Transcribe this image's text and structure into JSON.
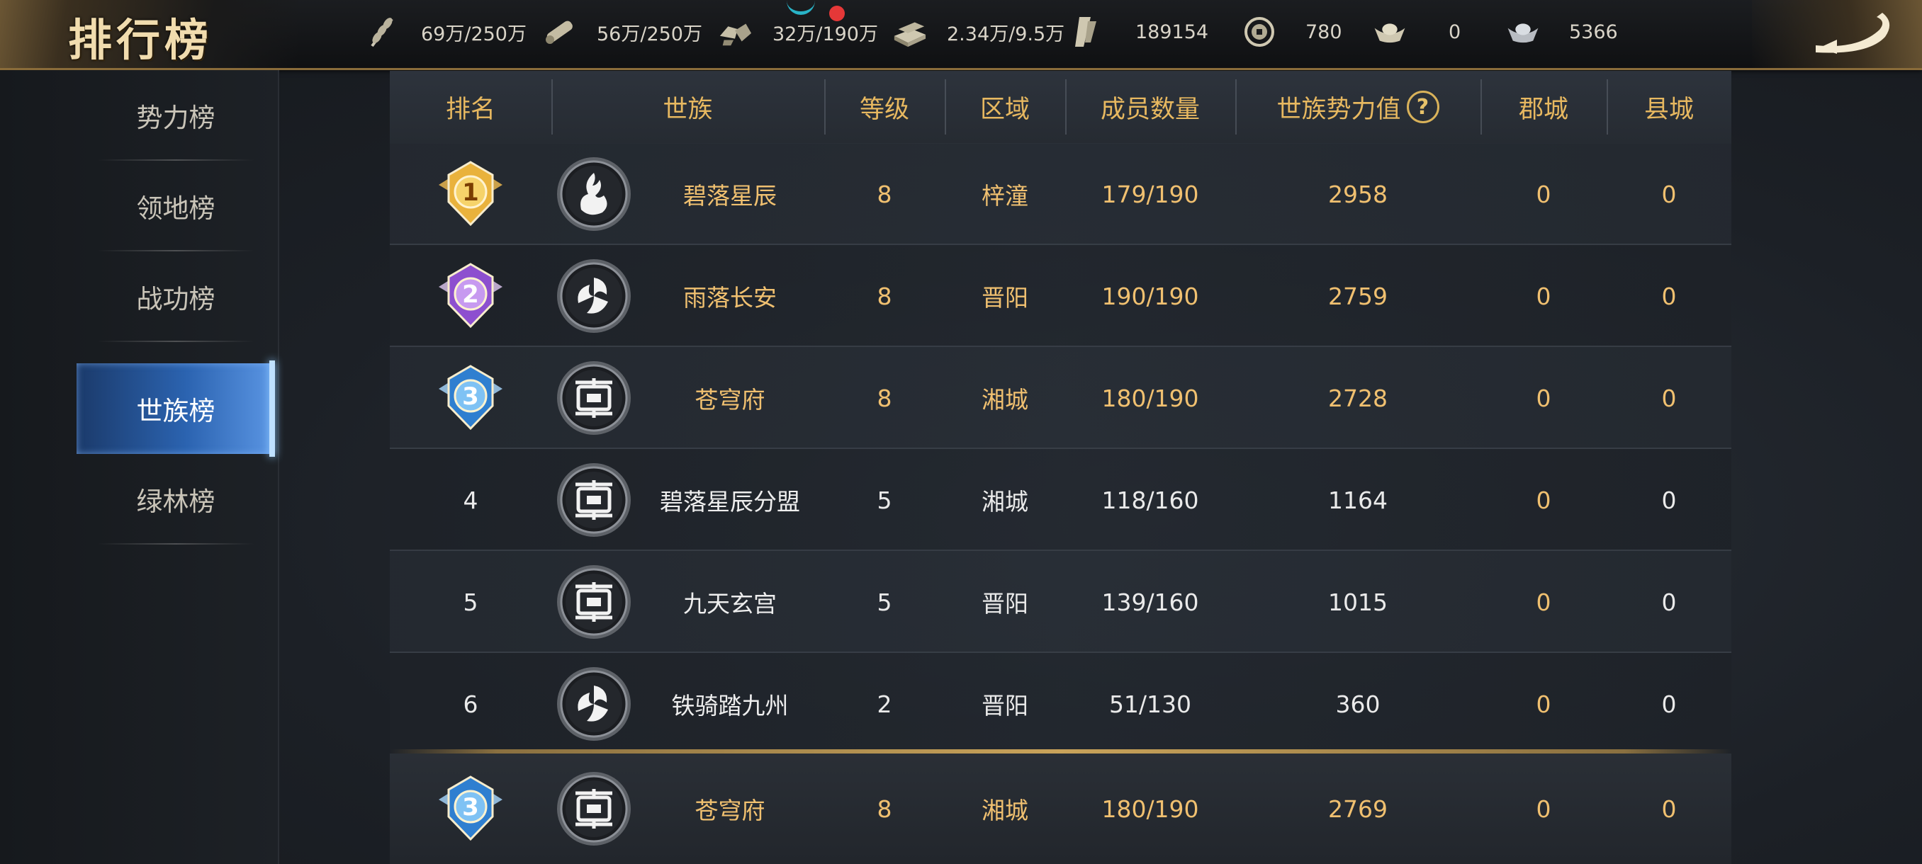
{
  "header": {
    "title": "排行榜",
    "resources": [
      {
        "icon": "grain-icon",
        "value": "69万/250万"
      },
      {
        "icon": "wood-icon",
        "value": "56万/250万"
      },
      {
        "icon": "stone-icon",
        "value": "32万/190万"
      },
      {
        "icon": "iron-icon",
        "value": "2.34万/9.5万"
      },
      {
        "icon": "decree-icon",
        "value": "189154"
      },
      {
        "icon": "copper-coin-icon",
        "value": "780"
      },
      {
        "icon": "gold-ingot-icon",
        "value": "0"
      },
      {
        "icon": "silver-ingot-icon",
        "value": "5366"
      }
    ],
    "back_icon": "back-arrow-icon"
  },
  "sidebar": {
    "items": [
      {
        "label": "势力榜",
        "active": false
      },
      {
        "label": "领地榜",
        "active": false
      },
      {
        "label": "战功榜",
        "active": false
      },
      {
        "label": "世族榜",
        "active": true
      },
      {
        "label": "绿林榜",
        "active": false
      }
    ]
  },
  "table": {
    "columns": [
      "排名",
      "世族",
      "等级",
      "区域",
      "成员数量",
      "世族势力值",
      "郡城",
      "县城"
    ],
    "help_icon": "?",
    "rows": [
      {
        "rank": "1",
        "medal": "gold",
        "emblem": "flame",
        "name": "碧落星辰",
        "level": "8",
        "region": "梓潼",
        "members": "179/190",
        "power": "2958",
        "jun": "0",
        "xian": "0",
        "style": "gold"
      },
      {
        "rank": "2",
        "medal": "purple",
        "emblem": "swirl",
        "name": "雨落长安",
        "level": "8",
        "region": "晋阳",
        "members": "190/190",
        "power": "2759",
        "jun": "0",
        "xian": "0",
        "style": "gold"
      },
      {
        "rank": "3",
        "medal": "blue",
        "emblem": "seal",
        "name": "苍穹府",
        "level": "8",
        "region": "湘城",
        "members": "180/190",
        "power": "2728",
        "jun": "0",
        "xian": "0",
        "style": "gold"
      },
      {
        "rank": "4",
        "medal": "",
        "emblem": "seal",
        "name": "碧落星辰分盟",
        "level": "5",
        "region": "湘城",
        "members": "118/160",
        "power": "1164",
        "jun": "0",
        "xian": "0",
        "style": "white"
      },
      {
        "rank": "5",
        "medal": "",
        "emblem": "seal",
        "name": "九天玄宫",
        "level": "5",
        "region": "晋阳",
        "members": "139/160",
        "power": "1015",
        "jun": "0",
        "xian": "0",
        "style": "white"
      },
      {
        "rank": "6",
        "medal": "",
        "emblem": "swirl",
        "name": "铁骑踏九州",
        "level": "2",
        "region": "晋阳",
        "members": "51/130",
        "power": "360",
        "jun": "0",
        "xian": "0",
        "style": "white"
      }
    ],
    "my_row": {
      "rank": "3",
      "medal": "blue",
      "emblem": "seal",
      "name": "苍穹府",
      "level": "8",
      "region": "湘城",
      "members": "180/190",
      "power": "2769",
      "jun": "0",
      "xian": "0"
    }
  },
  "colors": {
    "gold_text": "#f0c070",
    "header_text": "#e7b860",
    "active_tab": "#2b63b0",
    "record_dot": "#e53838"
  }
}
